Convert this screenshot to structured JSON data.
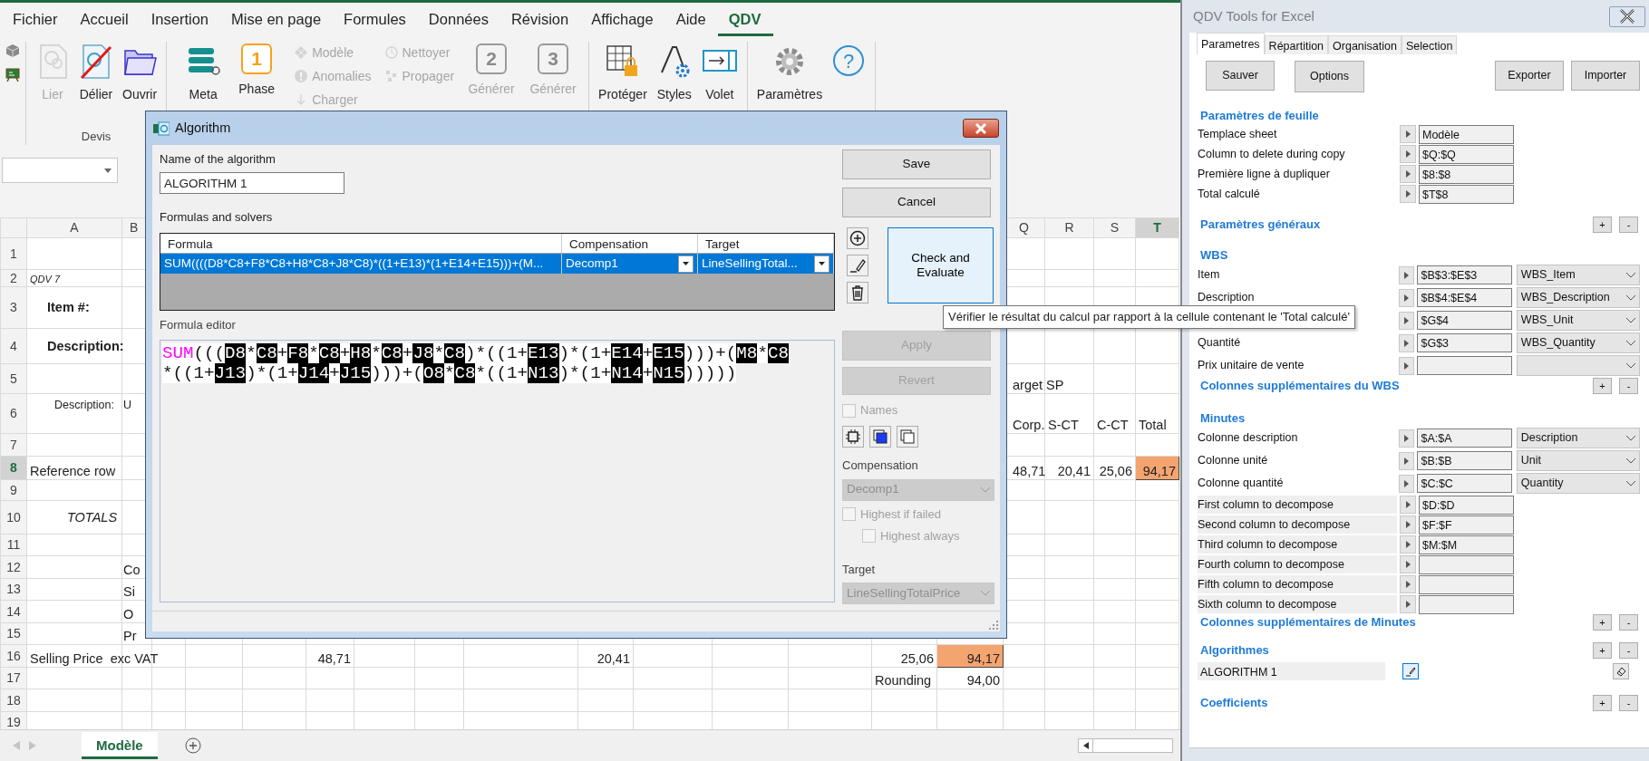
{
  "ribbon": {
    "tabs": [
      {
        "label": "Fichier",
        "selected": false
      },
      {
        "label": "Accueil",
        "selected": false
      },
      {
        "label": "Insertion",
        "selected": false
      },
      {
        "label": "Mise en page",
        "selected": false
      },
      {
        "label": "Formules",
        "selected": false
      },
      {
        "label": "Données",
        "selected": false
      },
      {
        "label": "Révision",
        "selected": false
      },
      {
        "label": "Affichage",
        "selected": false
      },
      {
        "label": "Aide",
        "selected": false
      },
      {
        "label": "QDV",
        "selected": true
      }
    ],
    "groups": [
      {
        "label": "Devis",
        "items": [
          {
            "kind": "large",
            "label": "Lier",
            "disabled": true
          },
          {
            "kind": "large",
            "label": "Délier",
            "disabled": false
          },
          {
            "kind": "large",
            "label": "Ouvrir",
            "disabled": false
          }
        ]
      },
      {
        "items": [
          {
            "kind": "large",
            "label": "Meta",
            "disabled": false
          },
          {
            "kind": "number",
            "label": "Phase",
            "number": "1",
            "disabled": false
          },
          {
            "kind": "stack",
            "entries": [
              {
                "label": "Modèle",
                "disabled": true
              },
              {
                "label": "Anomalies",
                "disabled": true
              },
              {
                "label": "Charger",
                "disabled": true
              }
            ]
          },
          {
            "kind": "stack",
            "entries": [
              {
                "label": "Nettoyer",
                "disabled": true
              },
              {
                "label": "Propager",
                "disabled": true
              }
            ]
          },
          {
            "kind": "number",
            "label": "Générer",
            "number": "2",
            "disabled": true
          },
          {
            "kind": "number",
            "label": "Générer",
            "number": "3",
            "disabled": true
          }
        ]
      },
      {
        "items": [
          {
            "kind": "large",
            "label": "Protéger",
            "disabled": false
          },
          {
            "kind": "large",
            "label": "Styles",
            "disabled": false
          },
          {
            "kind": "large",
            "label": "Volet",
            "disabled": false
          }
        ]
      },
      {
        "items": [
          {
            "kind": "large",
            "label": "Paramètres",
            "disabled": false
          },
          {
            "kind": "help",
            "label": "?",
            "disabled": false
          }
        ]
      }
    ]
  },
  "sheet": {
    "columns": [
      {
        "label": "A",
        "selected": false
      },
      {
        "label": "B",
        "selected": false
      },
      {
        "label": "Q",
        "selected": false
      },
      {
        "label": "R",
        "selected": false
      },
      {
        "label": "S",
        "selected": false
      },
      {
        "label": "T",
        "selected": true
      }
    ],
    "rows": [
      {
        "number": "1",
        "selected": false
      },
      {
        "number": "2",
        "selected": false,
        "cells": {
          "a": {
            "text": "QDV 7",
            "kind": "note"
          }
        }
      },
      {
        "number": "3",
        "selected": false,
        "cells": {
          "a": {
            "text": "Item #:",
            "kind": "bold"
          }
        }
      },
      {
        "number": "4",
        "selected": false,
        "cells": {
          "a": {
            "text": "Description:",
            "kind": "bold"
          }
        }
      },
      {
        "number": "5",
        "selected": false,
        "cells": {
          "q": {
            "text": "arget SP"
          }
        }
      },
      {
        "number": "6",
        "selected": false,
        "cells": {
          "a": {
            "text": "Description:",
            "kind": "small"
          },
          "b": {
            "text": "U",
            "kind": "small"
          },
          "q": {
            "text": "Corp."
          },
          "r": {
            "text": "S-CT"
          },
          "s": {
            "text": "C-CT"
          },
          "t": {
            "text": "Total"
          }
        }
      },
      {
        "number": "7",
        "selected": false
      },
      {
        "number": "8",
        "selected": true,
        "cells": {
          "a": {
            "text": "Reference row"
          },
          "q": {
            "text": "48,71"
          },
          "r": {
            "text": "20,41",
            "kind": "number"
          },
          "s": {
            "text": "25,06",
            "kind": "number"
          },
          "t": {
            "text": "94,17",
            "kind": "number",
            "highlighted": true
          }
        }
      },
      {
        "number": "9",
        "selected": false
      },
      {
        "number": "10",
        "selected": false,
        "cells": {
          "a": {
            "text": "TOTALS",
            "kind": "italic"
          }
        }
      },
      {
        "number": "11",
        "selected": false
      },
      {
        "number": "12",
        "selected": false,
        "cells": {
          "b": {
            "text": "Co"
          }
        }
      },
      {
        "number": "13",
        "selected": false,
        "cells": {
          "b": {
            "text": "Si"
          }
        }
      },
      {
        "number": "14",
        "selected": false,
        "cells": {
          "b": {
            "text": "O"
          }
        }
      },
      {
        "number": "15",
        "selected": false,
        "cells": {
          "b": {
            "text": "Pr"
          }
        }
      },
      {
        "number": "16",
        "selected": false,
        "cells": {
          "a": {
            "text": "Selling Price  exc VAT"
          },
          "f": {
            "text": "48,71",
            "kind": "number"
          },
          "j": {
            "text": "20,41",
            "kind": "number"
          },
          "n": {
            "text": "25,06",
            "kind": "number"
          },
          "o": {
            "text": "94,17",
            "kind": "number",
            "highlighted": true
          }
        }
      },
      {
        "number": "17",
        "selected": false,
        "cells": {
          "n": {
            "text": "Rounding"
          },
          "o": {
            "text": "94,00",
            "kind": "number"
          }
        }
      },
      {
        "number": "18",
        "selected": false
      },
      {
        "number": "19",
        "selected": false
      }
    ],
    "tabs": [
      {
        "label": "Modèle",
        "selected": true
      }
    ]
  },
  "dialog": {
    "title": "Algorithm",
    "name_label": "Name of the algorithm",
    "name_value": "ALGORITHM 1",
    "formulas_label": "Formulas and solvers",
    "grid": {
      "columns": [
        "Formula",
        "Compensation",
        "Target"
      ],
      "rows": [
        {
          "formula": "SUM((((D8*C8+F8*C8+H8*C8+J8*C8)*((1+E13)*(1+E14+E15)))+(M...",
          "compensation": "Decomp1",
          "target": "LineSellingTotal...",
          "selected": true
        }
      ]
    },
    "save": "Save",
    "cancel": "Cancel",
    "check": "Check and Evaluate",
    "editor_label": "Formula editor",
    "editor_lines": [
      [
        {
          "kind": "function",
          "text": "SUM"
        },
        {
          "kind": "op",
          "text": "((("
        },
        {
          "kind": "ref",
          "text": "D8"
        },
        {
          "kind": "op",
          "text": "*"
        },
        {
          "kind": "ref",
          "text": "C8"
        },
        {
          "kind": "op",
          "text": "+"
        },
        {
          "kind": "ref",
          "text": "F8"
        },
        {
          "kind": "op",
          "text": "*"
        },
        {
          "kind": "ref",
          "text": "C8"
        },
        {
          "kind": "op",
          "text": "+"
        },
        {
          "kind": "ref",
          "text": "H8"
        },
        {
          "kind": "op",
          "text": "*"
        },
        {
          "kind": "ref",
          "text": "C8"
        },
        {
          "kind": "op",
          "text": "+"
        },
        {
          "kind": "ref",
          "text": "J8"
        },
        {
          "kind": "op",
          "text": "*"
        },
        {
          "kind": "ref",
          "text": "C8"
        },
        {
          "kind": "op",
          "text": ")*((1+"
        },
        {
          "kind": "ref",
          "text": "E13"
        },
        {
          "kind": "op",
          "text": ")*(1+"
        },
        {
          "kind": "ref",
          "text": "E14"
        },
        {
          "kind": "op",
          "text": "+"
        },
        {
          "kind": "ref",
          "text": "E15"
        },
        {
          "kind": "op",
          "text": ")))+("
        },
        {
          "kind": "ref",
          "text": "M8"
        },
        {
          "kind": "op",
          "text": "*"
        },
        {
          "kind": "ref",
          "text": "C8"
        }
      ],
      [
        {
          "kind": "op",
          "text": "*((1+"
        },
        {
          "kind": "ref",
          "text": "J13"
        },
        {
          "kind": "op",
          "text": ")*(1+"
        },
        {
          "kind": "ref",
          "text": "J14"
        },
        {
          "kind": "op",
          "text": "+"
        },
        {
          "kind": "ref",
          "text": "J15"
        },
        {
          "kind": "op",
          "text": ")))+("
        },
        {
          "kind": "ref",
          "text": "O8"
        },
        {
          "kind": "op",
          "text": "*"
        },
        {
          "kind": "ref",
          "text": "C8"
        },
        {
          "kind": "op",
          "text": "*((1+"
        },
        {
          "kind": "ref",
          "text": "N13"
        },
        {
          "kind": "op",
          "text": ")*(1+"
        },
        {
          "kind": "ref",
          "text": "N14"
        },
        {
          "kind": "op",
          "text": "+"
        },
        {
          "kind": "ref",
          "text": "N15"
        },
        {
          "kind": "op",
          "text": ")))))"
        }
      ]
    ],
    "apply": {
      "label": "Apply",
      "disabled": true
    },
    "revert": {
      "label": "Revert",
      "disabled": true
    },
    "names": {
      "label": "Names",
      "checked": false,
      "disabled": true
    },
    "compensation_label": "Compensation",
    "compensation": {
      "value": "Decomp1",
      "disabled": true
    },
    "highest_if_failed": {
      "label": "Highest if failed",
      "checked": false,
      "disabled": true
    },
    "highest_always": {
      "label": "Highest always",
      "checked": false,
      "disabled": true
    },
    "target_label": "Target",
    "target": {
      "value": "LineSellingTotalPrice",
      "disabled": true
    }
  },
  "tooltip": {
    "text": "Vérifier le résultat du calcul par rapport à la cellule contenant le 'Total calculé'"
  },
  "pane": {
    "title": "QDV Tools for Excel",
    "tabs": [
      {
        "label": "Parametres",
        "selected": true
      },
      {
        "label": "Répartition",
        "selected": false
      },
      {
        "label": "Organisation",
        "selected": false
      },
      {
        "label": "Selection",
        "selected": false
      }
    ],
    "buttons": [
      "Sauver",
      "Options",
      "Exporter",
      "Importer"
    ],
    "sections": [
      {
        "title": "Paramètres de feuille",
        "rows": [
          {
            "kind": "field",
            "label": "Templace sheet",
            "value": "Modèle"
          },
          {
            "kind": "field",
            "label": "Column to delete during copy",
            "value": "$Q:$Q"
          },
          {
            "kind": "field",
            "label": "Première ligne à dupliquer",
            "value": "$8:$8"
          },
          {
            "kind": "field",
            "label": "Total calculé",
            "value": "$T$8"
          }
        ]
      },
      {
        "title": "Paramètres généraux",
        "buttons": [
          "+",
          "-"
        ]
      },
      {
        "title": "WBS",
        "rows": [
          {
            "kind": "combo",
            "label": "Item",
            "value": "$B$3:$E$3",
            "option": "WBS_Item"
          },
          {
            "kind": "combo",
            "label": "Description",
            "value": "$B$4:$E$4",
            "option": "WBS_Description"
          },
          {
            "kind": "combo",
            "value": "$G$4",
            "option": "WBS_Unit"
          },
          {
            "kind": "combo",
            "label": "Quantité",
            "value": "$G$3",
            "option": "WBS_Quantity"
          },
          {
            "kind": "combo",
            "label": "Prix unitaire de vente"
          }
        ]
      },
      {
        "title": "Colonnes supplémentaires du WBS",
        "buttons": [
          "+",
          "-"
        ]
      },
      {
        "title": "Minutes",
        "rows": [
          {
            "kind": "combo",
            "label": "Colonne description",
            "value": "$A:$A",
            "option": "Description"
          },
          {
            "kind": "combo",
            "label": "Colonne unité",
            "value": "$B:$B",
            "option": "Unit"
          },
          {
            "kind": "combo",
            "label": "Colonne quantité",
            "value": "$C:$C",
            "option": "Quantity"
          },
          {
            "kind": "decompose",
            "label": "First column to decompose",
            "value": "$D:$D"
          },
          {
            "kind": "decompose",
            "label": "Second column to decompose",
            "value": "$F:$F"
          },
          {
            "kind": "decompose",
            "label": "Third column to decompose",
            "value": "$M:$M"
          },
          {
            "kind": "decompose",
            "label": "Fourth column to decompose"
          },
          {
            "kind": "decompose",
            "label": "Fifth column to decompose"
          },
          {
            "kind": "decompose",
            "label": "Sixth column to decompose"
          }
        ]
      },
      {
        "title": "Colonnes supplémentaires de Minutes",
        "buttons": [
          "+",
          "-"
        ]
      },
      {
        "title": "Algorithmes",
        "buttons": [
          "+",
          "-"
        ],
        "rows": [
          {
            "kind": "algorithm",
            "label": "ALGORITHM 1"
          }
        ]
      },
      {
        "title": "Coefficients",
        "buttons": [
          "+",
          "-"
        ]
      }
    ]
  }
}
